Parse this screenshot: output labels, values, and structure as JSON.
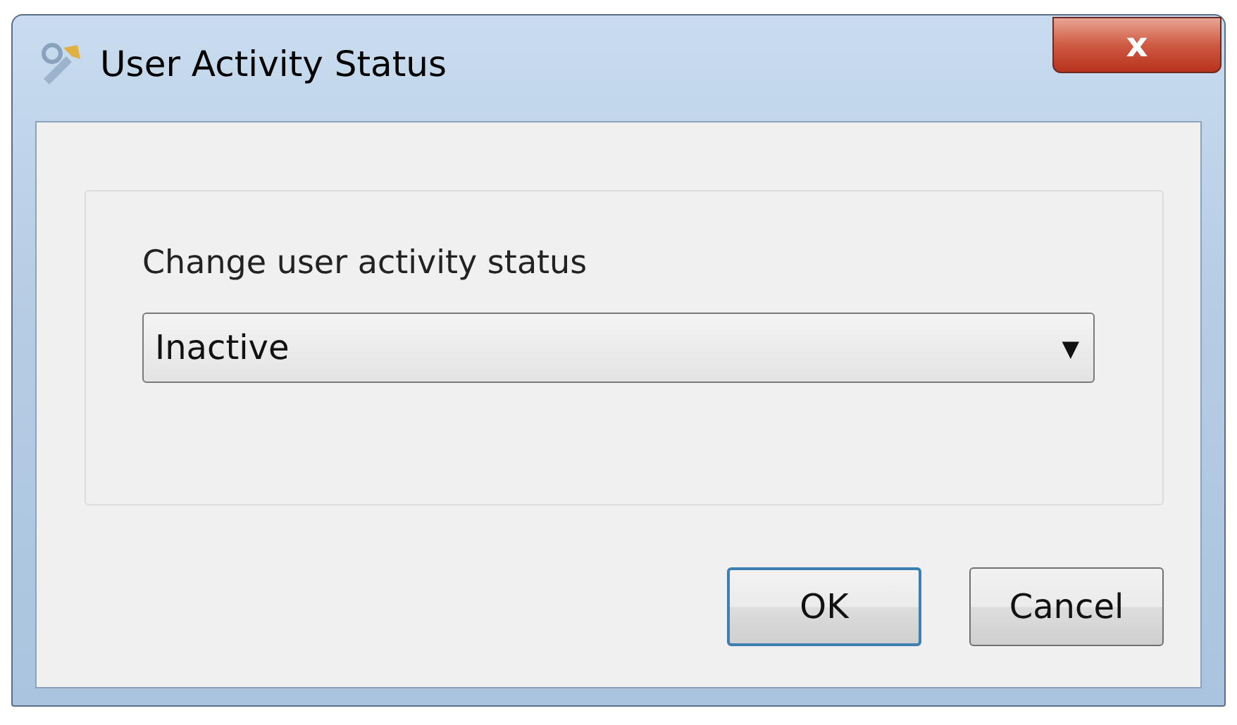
{
  "window": {
    "title": "User Activity Status",
    "close": "x"
  },
  "group": {
    "label": "Change user activity status",
    "dropdown": {
      "value": "Inactive",
      "arrow": "▼"
    }
  },
  "buttons": [
    {
      "label": "OK",
      "kind": "default"
    },
    {
      "label": "Cancel",
      "kind": "normal"
    }
  ]
}
